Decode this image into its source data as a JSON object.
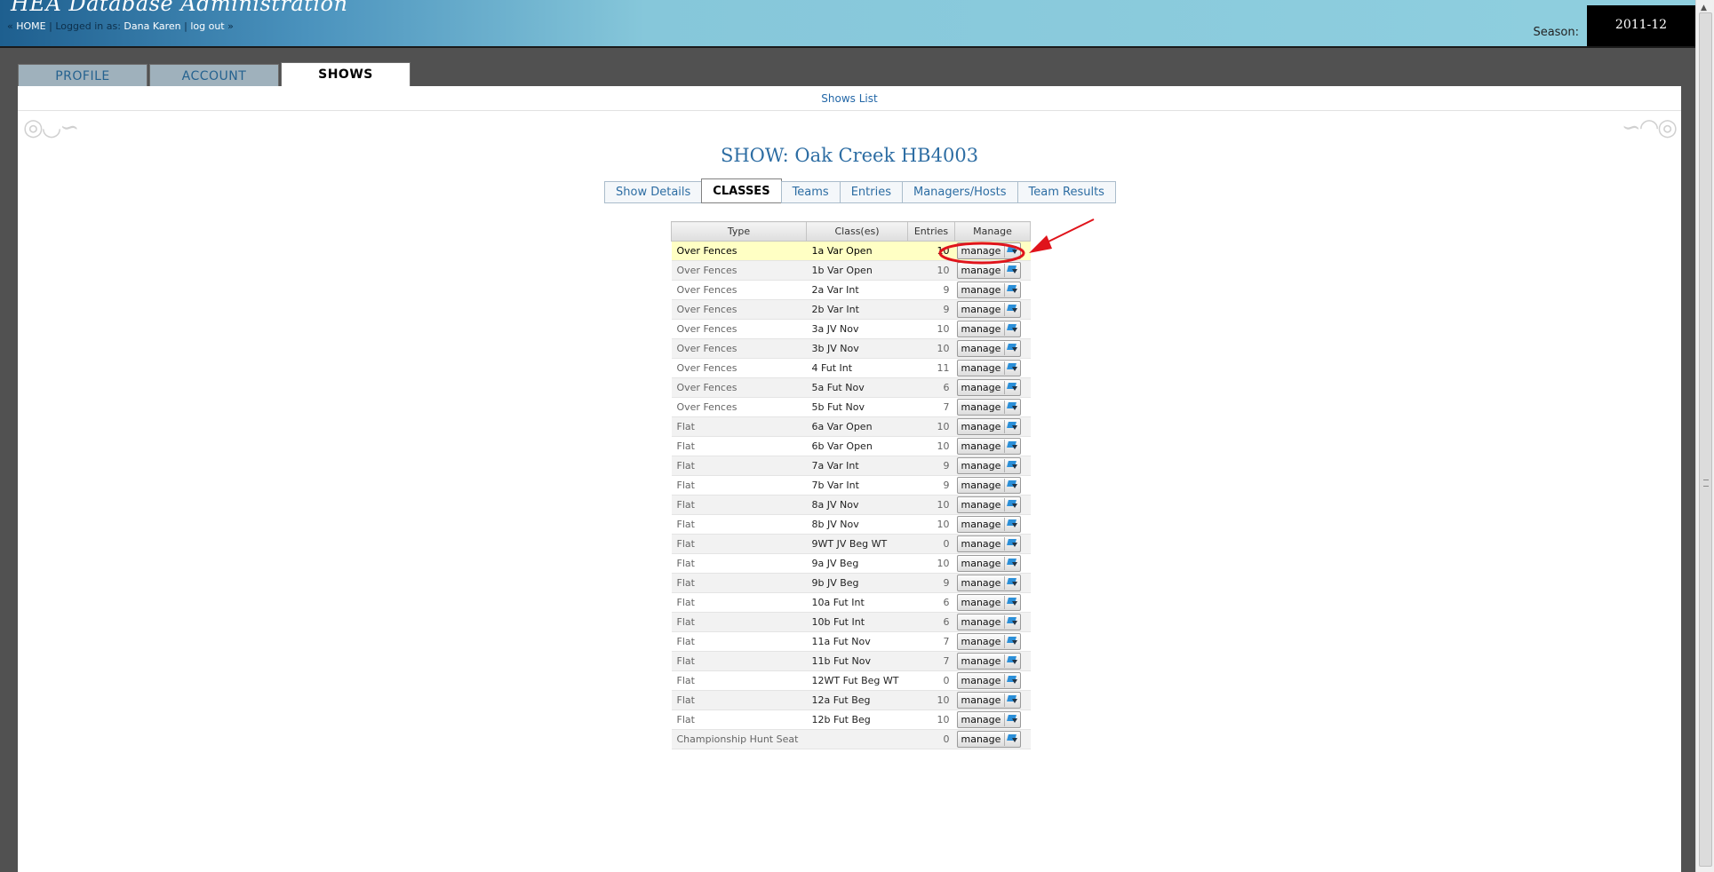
{
  "header": {
    "app_title": "HEA Database Administration",
    "home_link": "HOME",
    "logged_in_label": "Logged in as:",
    "user_name": "Dana Karen",
    "logout_link": "log out",
    "season_label": "Season:",
    "season_value": "2011-12"
  },
  "main_tabs": {
    "profile": "PROFILE",
    "account": "ACCOUNT",
    "shows": "SHOWS"
  },
  "shows_list_link": "Shows List",
  "show_title": "SHOW: Oak Creek HB4003",
  "sub_tabs": {
    "show_details": "Show Details",
    "classes": "CLASSES",
    "teams": "Teams",
    "entries": "Entries",
    "managers_hosts": "Managers/Hosts",
    "team_results": "Team Results"
  },
  "table": {
    "headers": {
      "type": "Type",
      "classes": "Class(es)",
      "entries": "Entries",
      "manage": "Manage"
    },
    "manage_label": "manage",
    "rows": [
      {
        "type": "Over Fences",
        "class": "1a Var Open",
        "entries": "10"
      },
      {
        "type": "Over Fences",
        "class": "1b Var Open",
        "entries": "10"
      },
      {
        "type": "Over Fences",
        "class": "2a Var Int",
        "entries": "9"
      },
      {
        "type": "Over Fences",
        "class": "2b Var Int",
        "entries": "9"
      },
      {
        "type": "Over Fences",
        "class": "3a JV Nov",
        "entries": "10"
      },
      {
        "type": "Over Fences",
        "class": "3b JV Nov",
        "entries": "10"
      },
      {
        "type": "Over Fences",
        "class": "4 Fut Int",
        "entries": "11"
      },
      {
        "type": "Over Fences",
        "class": "5a Fut Nov",
        "entries": "6"
      },
      {
        "type": "Over Fences",
        "class": "5b Fut Nov",
        "entries": "7"
      },
      {
        "type": "Flat",
        "class": "6a Var Open",
        "entries": "10"
      },
      {
        "type": "Flat",
        "class": "6b Var Open",
        "entries": "10"
      },
      {
        "type": "Flat",
        "class": "7a Var Int",
        "entries": "9"
      },
      {
        "type": "Flat",
        "class": "7b Var Int",
        "entries": "9"
      },
      {
        "type": "Flat",
        "class": "8a JV Nov",
        "entries": "10"
      },
      {
        "type": "Flat",
        "class": "8b JV Nov",
        "entries": "10"
      },
      {
        "type": "Flat",
        "class": "9WT JV Beg WT",
        "entries": "0"
      },
      {
        "type": "Flat",
        "class": "9a JV Beg",
        "entries": "10"
      },
      {
        "type": "Flat",
        "class": "9b JV Beg",
        "entries": "9"
      },
      {
        "type": "Flat",
        "class": "10a Fut Int",
        "entries": "6"
      },
      {
        "type": "Flat",
        "class": "10b Fut Int",
        "entries": "6"
      },
      {
        "type": "Flat",
        "class": "11a Fut Nov",
        "entries": "7"
      },
      {
        "type": "Flat",
        "class": "11b Fut Nov",
        "entries": "7"
      },
      {
        "type": "Flat",
        "class": "12WT Fut Beg WT",
        "entries": "0"
      },
      {
        "type": "Flat",
        "class": "12a Fut Beg",
        "entries": "10"
      },
      {
        "type": "Flat",
        "class": "12b Fut Beg",
        "entries": "10"
      },
      {
        "type": "Championship Hunt Seat",
        "class": "",
        "entries": "0"
      }
    ]
  },
  "colors": {
    "link": "#2367a7",
    "highlight_row": "#ffffc4",
    "annotation": "#e0141b",
    "frame": "#515151"
  },
  "icons": {
    "manage_icon": "edit-icon",
    "left_ornament": "scroll-ornament-icon",
    "right_ornament": "scroll-ornament-icon"
  }
}
